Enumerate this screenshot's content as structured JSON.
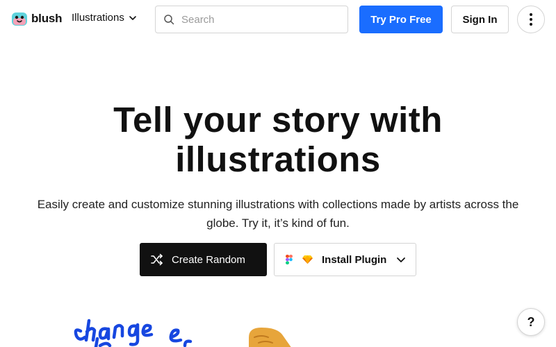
{
  "brand": {
    "name": "blush"
  },
  "nav": {
    "menu_label": "Illustrations",
    "search_placeholder": "Search",
    "pro_label": "Try Pro Free",
    "signin_label": "Sign In"
  },
  "hero": {
    "title": "Tell your story with illustrations",
    "subtitle": "Easily create and customize stunning illustrations with collections made by artists across the globe. Try it, it’s kind of fun.",
    "random_label": "Create Random",
    "plugin_label": "Install Plugin"
  },
  "help": {
    "label": "?"
  },
  "colors": {
    "accent": "#1a6dff",
    "dark_button": "#111111",
    "border": "#d4d4d4"
  },
  "icons": [
    "blush-logo",
    "chevron-down-icon",
    "search-icon",
    "more-vertical-icon",
    "shuffle-icon",
    "figma-icon",
    "sketch-icon",
    "help-icon"
  ]
}
